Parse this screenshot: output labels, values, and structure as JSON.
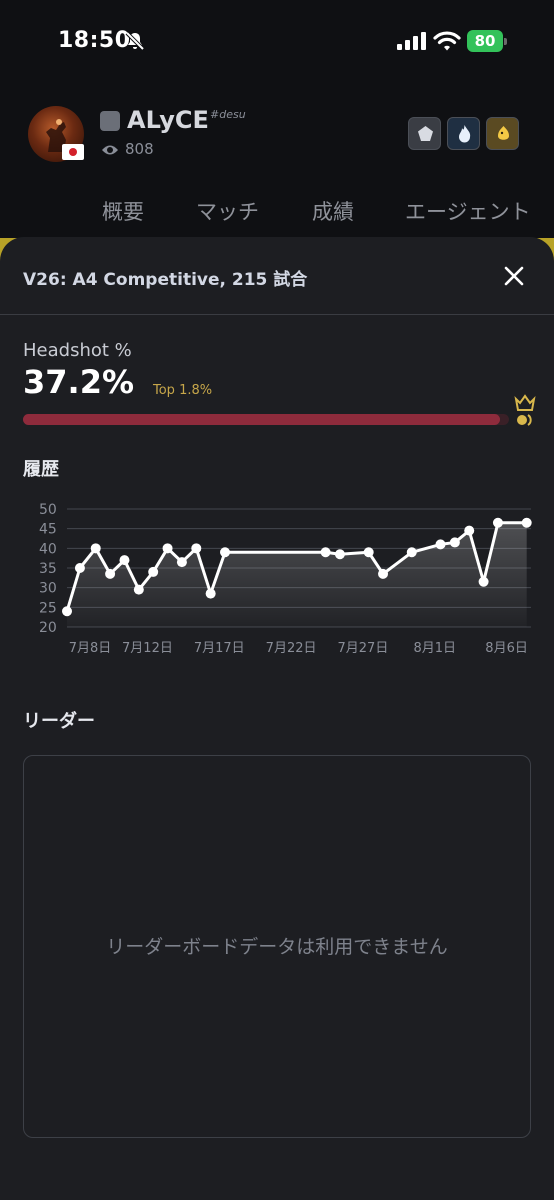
{
  "status_bar": {
    "time": "18:50",
    "battery": "80",
    "icons": [
      "bell-slash-icon",
      "signal-icon",
      "wifi-icon",
      "battery-icon"
    ]
  },
  "profile": {
    "name": "ALyCE",
    "tag": "#desu",
    "views": "808",
    "country_flag": "japan-flag-icon",
    "badges": [
      "pentagon-badge-icon",
      "flame-badge-icon",
      "chick-badge-icon"
    ]
  },
  "tabs": [
    "概要",
    "マッチ",
    "成績",
    "エージェント"
  ],
  "sheet": {
    "title": "V26: A4 Competitive, 215 試合",
    "stat_label": "Headshot %",
    "stat_value": "37.2%",
    "top_text": "Top 1.8%",
    "progress_percent": 98.2,
    "history_title": "履歴",
    "leader_title": "リーダー",
    "leader_empty": "リーダーボードデータは利用できません"
  },
  "colors": {
    "accent_red": "#8e2b3c",
    "gold": "#c6a64a",
    "battery_green": "#33c25a"
  },
  "chart_data": {
    "type": "line",
    "ylim": [
      20,
      50
    ],
    "yticks": [
      20,
      25,
      30,
      35,
      40,
      45,
      50
    ],
    "grid": true,
    "xtick_labels": [
      "7月8日",
      "7月12日",
      "7月17日",
      "7月22日",
      "7月27日",
      "8月1日",
      "8月6日"
    ],
    "xtick_days": [
      8,
      12,
      17,
      22,
      27,
      32,
      37
    ],
    "x_range": [
      6.4,
      38.7
    ],
    "series": [
      {
        "x": [
          6.4,
          7.3,
          8.4,
          9.4,
          10.4,
          11.4,
          12.4,
          13.4,
          14.4,
          15.4,
          16.4,
          17.4,
          24.4,
          25.4,
          27.4,
          28.4,
          30.4,
          32.4,
          33.4,
          34.4,
          35.4,
          36.4,
          38.4
        ],
        "values": [
          24,
          35,
          40,
          33.5,
          37,
          29.5,
          34,
          40,
          36.5,
          40,
          28.5,
          39,
          39,
          38.5,
          39,
          33.5,
          39,
          41,
          41.5,
          44.5,
          31.5,
          46.5,
          46.5
        ]
      }
    ]
  }
}
